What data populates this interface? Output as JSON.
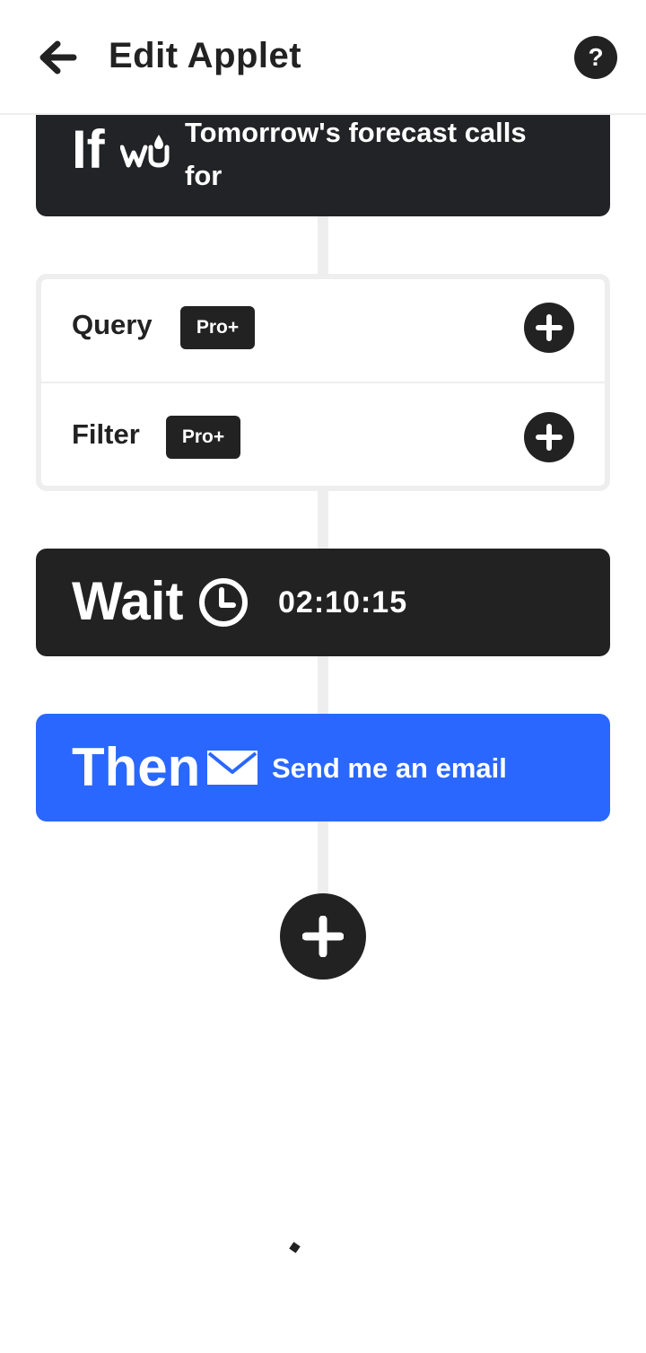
{
  "header": {
    "title": "Edit Applet",
    "help_label": "?"
  },
  "trigger": {
    "keyword": "If",
    "service_icon": "weather-underground-icon",
    "text": "Tomorrow's forecast calls for"
  },
  "query": {
    "label": "Query",
    "badge": "Pro+"
  },
  "filter": {
    "label": "Filter",
    "badge": "Pro+"
  },
  "wait": {
    "keyword": "Wait",
    "icon": "clock-icon",
    "time": "02:10:15"
  },
  "action": {
    "keyword": "Then",
    "icon": "mail-icon",
    "text": "Send me an email",
    "color": "#2a67fe"
  },
  "colors": {
    "dark": "#222222",
    "trigger_bg": "#222326",
    "connector": "#eeeeee",
    "action_blue": "#2a67fe"
  }
}
